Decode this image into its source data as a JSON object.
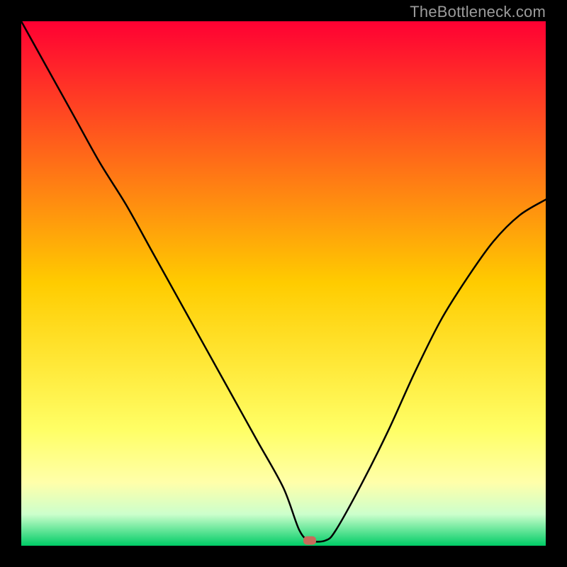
{
  "watermark": "TheBottleneck.com",
  "chart_data": {
    "type": "line",
    "title": "",
    "xlabel": "",
    "ylabel": "",
    "xlim": [
      0,
      100
    ],
    "ylim": [
      0,
      100
    ],
    "grid": false,
    "series": [
      {
        "name": "bottleneck-curve",
        "x": [
          0,
          5,
          10,
          15,
          20,
          25,
          30,
          35,
          40,
          45,
          50,
          53,
          55,
          58,
          60,
          65,
          70,
          75,
          80,
          85,
          90,
          95,
          100
        ],
        "values": [
          100,
          91,
          82,
          73,
          65,
          56,
          47,
          38,
          29,
          20,
          11,
          3,
          1,
          1,
          3,
          12,
          22,
          33,
          43,
          51,
          58,
          63,
          66
        ]
      }
    ],
    "marker": {
      "x": 55,
      "y": 1
    },
    "background_gradient": {
      "stops": [
        {
          "pos": 0.0,
          "color": "#ff0033"
        },
        {
          "pos": 0.5,
          "color": "#ffcc00"
        },
        {
          "pos": 0.78,
          "color": "#ffff66"
        },
        {
          "pos": 0.88,
          "color": "#ffffaa"
        },
        {
          "pos": 0.94,
          "color": "#ccffcc"
        },
        {
          "pos": 0.97,
          "color": "#66e699"
        },
        {
          "pos": 1.0,
          "color": "#00cc66"
        }
      ]
    }
  }
}
